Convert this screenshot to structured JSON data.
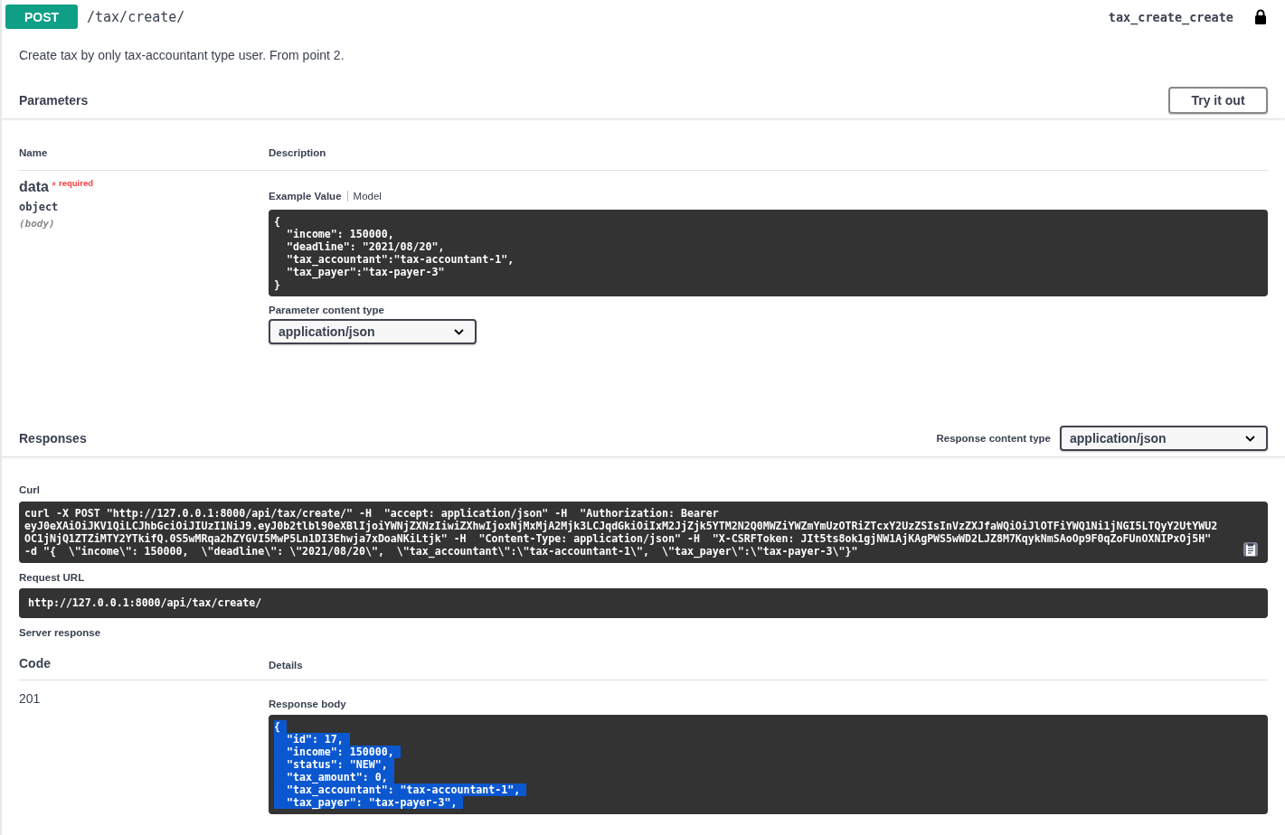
{
  "operation": {
    "method": "POST",
    "path": "/tax/create/",
    "operation_id": "tax_create_create",
    "locked": true,
    "description": "Create tax by only tax-accountant type user. From point 2."
  },
  "parameters": {
    "title": "Parameters",
    "try_button": "Try it out",
    "columns": [
      "Name",
      "Description"
    ],
    "items": [
      {
        "name": "data",
        "required_mark": "*",
        "required_label": "required",
        "type": "object",
        "location": "(body)",
        "tabs": [
          {
            "label": "Example Value",
            "selected": true
          },
          {
            "label": "Model",
            "selected": false
          }
        ],
        "example_lines": [
          "{",
          "  \"income\": 150000,",
          "  \"deadline\": \"2021/08/20\",",
          "  \"tax_accountant\":\"tax-accountant-1\",",
          "  \"tax_payer\":\"tax-payer-3\"",
          "}"
        ],
        "content_type_label": "Parameter content type",
        "content_type": "application/json"
      }
    ]
  },
  "responses": {
    "title": "Responses",
    "content_type_label": "Response content type",
    "content_type": "application/json",
    "curl_label": "Curl",
    "curl_lines": [
      "curl -X POST \"http://127.0.0.1:8000/api/tax/create/\" -H  \"accept: application/json\" -H  \"Authorization: Bearer",
      "eyJ0eXAiOiJKV1QiLCJhbGciOiJIUzI1NiJ9.eyJ0b2tlbl90eXBlIjoiYWNjZXNzIiwiZXhwIjoxNjMxMjA2Mjk3LCJqdGkiOiIxM2JjZjk5YTM2N2Q0MWZiYWZmYmUzOTRiZTcxY2UzZSIsInVzZXJfaWQiOiJlOTFiYWQ1Ni1jNGI5LTQyY2UtYWU2",
      "OC1jNjQ1ZTZiMTY2YTkifQ.0S5wMRqa2hZYGVI5MwP5Ln1DI3Ehwja7xDoaNKiLtjk\" -H  \"Content-Type: application/json\" -H  \"X-CSRFToken: JIt5ts8ok1gjNW1AjKAgPWS5wWD2LJZ8M7KqykNmSAoOp9F0qZoFUnOXNIPxOj5H\"",
      "-d \"{  \\\"income\\\": 150000,  \\\"deadline\\\": \\\"2021/08/20\\\",  \\\"tax_accountant\\\":\\\"tax-accountant-1\\\",  \\\"tax_payer\\\":\\\"tax-payer-3\\\"}\""
    ],
    "request_url_label": "Request URL",
    "request_url": "http://127.0.0.1:8000/api/tax/create/",
    "server_response_label": "Server response",
    "columns": [
      "Code",
      "Details"
    ],
    "code": "201",
    "body_label": "Response body",
    "body_text_selected": true,
    "body_lines": [
      "{",
      "  \"id\": 17,",
      "  \"income\": 150000,",
      "  \"status\": \"NEW\",",
      "  \"tax_amount\": 0,",
      "  \"tax_accountant\": \"tax-accountant-1\",",
      "  \"tax_payer\": \"tax-payer-3\","
    ]
  }
}
